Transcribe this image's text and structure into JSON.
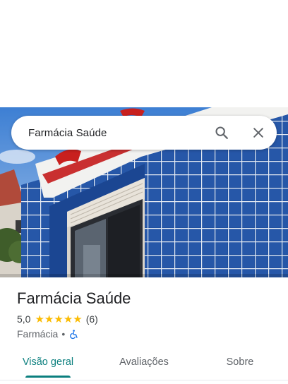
{
  "search": {
    "query": "Farmácia Saúde"
  },
  "place": {
    "name": "Farmácia Saúde",
    "rating": "5,0",
    "stars_filled": 5,
    "review_count": "(6)",
    "category": "Farmácia",
    "separator": "•",
    "accessibility_icon": "wheelchair-icon"
  },
  "tabs": [
    {
      "label": "Visão geral",
      "active": true
    },
    {
      "label": "Avaliações",
      "active": false
    },
    {
      "label": "Sobre",
      "active": false
    }
  ],
  "colors": {
    "accent": "#0b7f7e",
    "star": "#fbbc04",
    "accessibility": "#1a73e8"
  }
}
